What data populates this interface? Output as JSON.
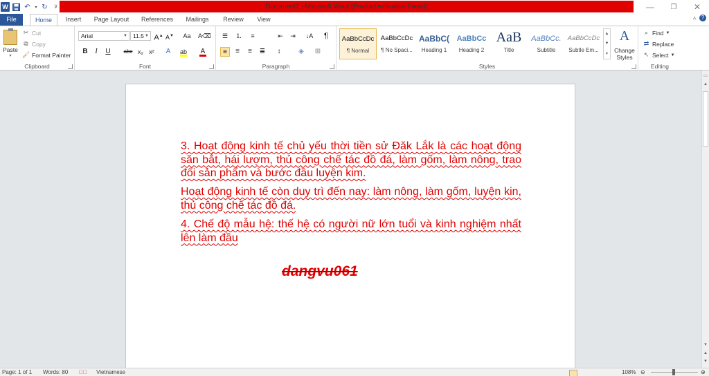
{
  "window": {
    "title": "Document1 - Microsoft Word (Product Activation Failed)",
    "title_bar_color": "#e00000"
  },
  "quick_access": {
    "icons": [
      "word-logo",
      "save-icon",
      "undo-icon",
      "redo-icon",
      "customize-icon"
    ],
    "word_letter": "W"
  },
  "tabs": {
    "file": "File",
    "items": [
      "Home",
      "Insert",
      "Page Layout",
      "References",
      "Mailings",
      "Review",
      "View"
    ],
    "active": "Home"
  },
  "ribbon": {
    "clipboard": {
      "label": "Clipboard",
      "paste": "Paste",
      "cut": "Cut",
      "copy": "Copy",
      "format_painter": "Format Painter"
    },
    "font": {
      "label": "Font",
      "font_name": "Arial",
      "font_size": "11.5",
      "bold": "B",
      "italic": "I",
      "underline": "U",
      "strikethrough": "abc",
      "subscript": "x₂",
      "superscript": "x²",
      "grow": "A",
      "shrink": "A",
      "change_case": "Aa",
      "text_effects": "A",
      "font_color": "A",
      "highlight_color": "#ffff00",
      "font_color_value": "#e00000"
    },
    "paragraph": {
      "label": "Paragraph",
      "show_marks": "¶"
    },
    "styles": {
      "label": "Styles",
      "items": [
        {
          "sample": "AaBbCcDc",
          "name": "¶ Normal",
          "selected": true
        },
        {
          "sample": "AaBbCcDc",
          "name": "¶ No Spaci...",
          "selected": false
        },
        {
          "sample": "AaBbC(",
          "name": "Heading 1",
          "selected": false
        },
        {
          "sample": "AaBbCc",
          "name": "Heading 2",
          "selected": false
        },
        {
          "sample": "AaB",
          "name": "Title",
          "selected": false
        },
        {
          "sample": "AaBbCc.",
          "name": "Subtitle",
          "selected": false
        },
        {
          "sample": "AaBbCcDc",
          "name": "Subtle Em...",
          "selected": false
        }
      ],
      "change_styles": "Change Styles"
    },
    "editing": {
      "label": "Editing",
      "find": "Find",
      "replace": "Replace",
      "select": "Select"
    }
  },
  "document": {
    "paragraphs": [
      "3. Hoạt động kinh tế chủ yếu thời tiền sử Đăk Lắk là các hoạt động săn bắt, hái lượm, thủ công chế tác đồ đá, làm gốm, làm nông, trao đổi sản phẩm và bước đầu luyện kim.",
      "Hoạt động kinh tế còn duy trì đến nay: làm nông, làm gốm, luyện kin, thủ công chế tác đồ đá.",
      "4. Chế độ mẫu hệ: thế hệ có người nữ lớn tuổi và kinh nghiệm nhất lên làm đầu"
    ],
    "signature": "dangvu061",
    "text_color": "#e00000"
  },
  "status": {
    "page": "Page: 1 of 1",
    "words": "Words: 80",
    "language": "Vietnamese",
    "zoom": "108%"
  }
}
